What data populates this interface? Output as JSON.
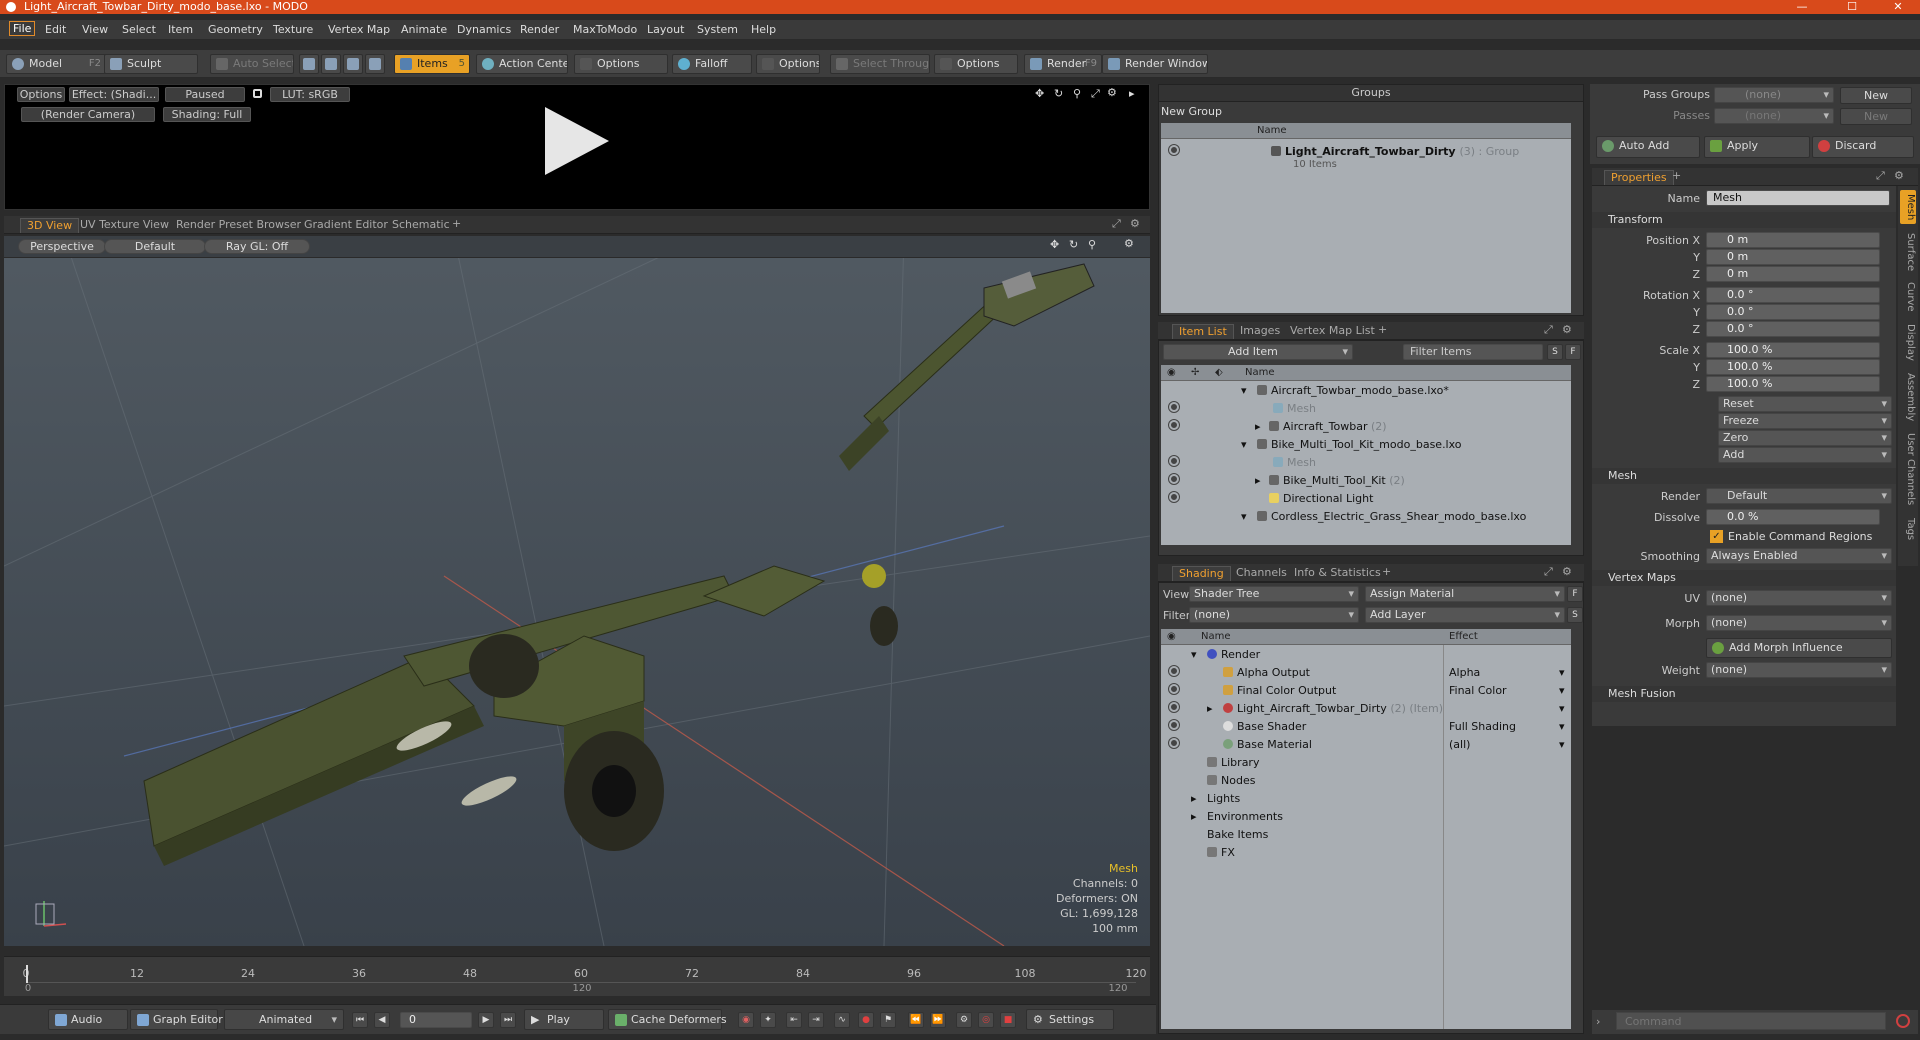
{
  "window": {
    "title": "Light_Aircraft_Towbar_Dirty_modo_base.lxo - MODO",
    "minimize": "—",
    "maximize": "☐",
    "close": "✕"
  },
  "menu": [
    "File",
    "Edit",
    "View",
    "Select",
    "Item",
    "Geometry",
    "Texture",
    "Vertex Map",
    "Animate",
    "Dynamics",
    "Render",
    "MaxToModo",
    "Layout",
    "System",
    "Help"
  ],
  "toolbar": {
    "model": "Model",
    "model_key": "F2",
    "sculpt": "Sculpt",
    "auto_select": "Auto Select",
    "items": "Items",
    "items_key": "5",
    "action_center": "Action Center",
    "options1": "Options",
    "falloff": "Falloff",
    "options2": "Options",
    "select_through": "Select Through",
    "options3": "Options",
    "render": "Render",
    "render_key": "F9",
    "render_window": "Render Window"
  },
  "render_preview": {
    "options": "Options",
    "effect": "Effect: (Shadi...",
    "paused": "Paused",
    "lut": "LUT: sRGB",
    "camera": "(Render Camera)",
    "shading": "Shading: Full"
  },
  "viewport_tabs": [
    "3D View",
    "UV Texture View",
    "Render Preset Browser",
    "Gradient Editor",
    "Schematic"
  ],
  "viewport": {
    "perspective": "Perspective",
    "default": "Default",
    "raygl": "Ray GL: Off",
    "info": {
      "mesh": "Mesh",
      "channels": "Channels: 0",
      "deformers": "Deformers: ON",
      "gl": "GL: 1,699,128",
      "scale": "100 mm"
    }
  },
  "timeline": {
    "ticks": [
      "0",
      "12",
      "24",
      "36",
      "48",
      "60",
      "72",
      "84",
      "96",
      "108",
      "120"
    ],
    "sub_ticks": [
      "0",
      "120",
      "120"
    ]
  },
  "transport": {
    "audio": "Audio",
    "graph_editor": "Graph Editor",
    "animated": "Animated",
    "frame": "0",
    "play": "Play",
    "cache_deformers": "Cache Deformers",
    "settings": "Settings"
  },
  "groups": {
    "title": "Groups",
    "new_group": "New Group",
    "col_name": "Name",
    "item_name": "Light_Aircraft_Towbar_Dirty",
    "item_suffix": "(3) : Group",
    "item_sub": "10 Items"
  },
  "item_list": {
    "tabs": [
      "Item List",
      "Images",
      "Vertex Map List"
    ],
    "add_item": "Add Item",
    "filter": "Filter Items",
    "col_name": "Name",
    "s": "S",
    "f": "F",
    "rows": [
      {
        "label": "Aircraft_Towbar_modo_base.lxo*",
        "suffix": ""
      },
      {
        "label": "Mesh",
        "suffix": ""
      },
      {
        "label": "Aircraft_Towbar",
        "suffix": "(2)"
      },
      {
        "label": "Bike_Multi_Tool_Kit_modo_base.lxo",
        "suffix": ""
      },
      {
        "label": "Mesh",
        "suffix": ""
      },
      {
        "label": "Bike_Multi_Tool_Kit",
        "suffix": "(2)"
      },
      {
        "label": "Directional Light",
        "suffix": ""
      },
      {
        "label": "Cordless_Electric_Grass_Shear_modo_base.lxo",
        "suffix": ""
      }
    ]
  },
  "shading": {
    "tabs": [
      "Shading",
      "Channels",
      "Info & Statistics"
    ],
    "view_label": "View",
    "view_value": "Shader Tree",
    "assign_material": "Assign Material",
    "f": "F",
    "filter_label": "Filter",
    "filter_value": "(none)",
    "add_layer": "Add Layer",
    "s": "S",
    "col_name": "Name",
    "col_effect": "Effect",
    "rows": [
      {
        "label": "Render",
        "effect": ""
      },
      {
        "label": "Alpha Output",
        "effect": "Alpha"
      },
      {
        "label": "Final Color Output",
        "effect": "Final Color"
      },
      {
        "label": "Light_Aircraft_Towbar_Dirty",
        "suffix": "(2) (Item)",
        "effect": ""
      },
      {
        "label": "Base Shader",
        "effect": "Full Shading"
      },
      {
        "label": "Base Material",
        "effect": "(all)"
      },
      {
        "label": "Library",
        "effect": ""
      },
      {
        "label": "Nodes",
        "effect": ""
      },
      {
        "label": "Lights",
        "effect": ""
      },
      {
        "label": "Environments",
        "effect": ""
      },
      {
        "label": "Bake Items",
        "effect": ""
      },
      {
        "label": "FX",
        "effect": ""
      }
    ]
  },
  "passes": {
    "pass_groups": "Pass Groups",
    "pass_value": "(none)",
    "new1": "New",
    "passes": "Passes",
    "passes_value": "(none)",
    "new2": "New",
    "auto_add": "Auto Add",
    "apply": "Apply",
    "discard": "Discard"
  },
  "properties": {
    "tab": "Properties",
    "name_label": "Name",
    "name_value": "Mesh",
    "transform": "Transform",
    "pos_label": "Position X",
    "rot_label": "Rotation X",
    "scale_label": "Scale X",
    "y": "Y",
    "z": "Z",
    "pos": [
      "0 m",
      "0 m",
      "0 m"
    ],
    "rot": [
      "0.0 °",
      "0.0 °",
      "0.0 °"
    ],
    "scale": [
      "100.0 %",
      "100.0 %",
      "100.0 %"
    ],
    "reset": "Reset",
    "freeze": "Freeze",
    "zero": "Zero",
    "add": "Add",
    "mesh_sect": "Mesh",
    "render_label": "Render",
    "render_value": "Default",
    "dissolve_label": "Dissolve",
    "dissolve_value": "0.0 %",
    "enable_cmd": "Enable Command Regions",
    "smoothing_label": "Smoothing",
    "smoothing_value": "Always Enabled",
    "vmaps_sect": "Vertex Maps",
    "uv_label": "UV",
    "uv_value": "(none)",
    "morph_label": "Morph",
    "morph_value": "(none)",
    "add_morph": "Add Morph Influence",
    "weight_label": "Weight",
    "weight_value": "(none)",
    "mesh_fusion": "Mesh Fusion",
    "side_tabs": [
      "Mesh",
      "Surface",
      "Curve",
      "Display",
      "Assembly",
      "User Channels",
      "Tags"
    ]
  },
  "command": {
    "placeholder": "Command"
  }
}
